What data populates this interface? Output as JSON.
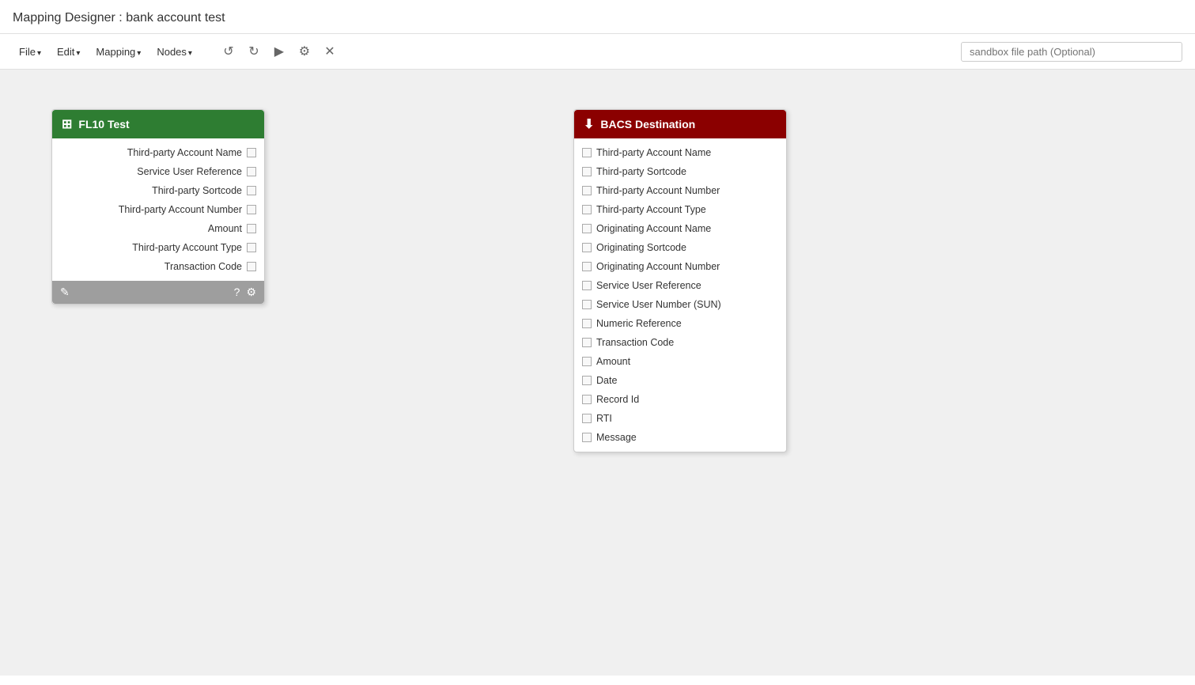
{
  "title": "Mapping Designer : bank account test",
  "toolbar": {
    "file_label": "File",
    "edit_label": "Edit",
    "mapping_label": "Mapping",
    "nodes_label": "Nodes",
    "undo_icon": "↺",
    "redo_icon": "↻",
    "run_icon": "▶",
    "settings_icon": "⚙",
    "close_icon": "✕",
    "sandbox_placeholder": "sandbox file path (Optional)"
  },
  "fl10_node": {
    "title": "FL10 Test",
    "header_icon": "⊞",
    "fields": [
      "Third-party Account Name",
      "Service User Reference",
      "Third-party Sortcode",
      "Third-party Account Number",
      "Amount",
      "Third-party Account Type",
      "Transaction Code"
    ],
    "footer_edit_icon": "✎",
    "footer_help_icon": "?",
    "footer_gear_icon": "⚙"
  },
  "bacs_node": {
    "title": "BACS Destination",
    "header_icon": "⬇",
    "fields": [
      "Third-party Account Name",
      "Third-party Sortcode",
      "Third-party Account Number",
      "Third-party Account Type",
      "Originating Account Name",
      "Originating Sortcode",
      "Originating Account Number",
      "Service User Reference",
      "Service User Number (SUN)",
      "Numeric Reference",
      "Transaction Code",
      "Amount",
      "Date",
      "Record Id",
      "RTI",
      "Message"
    ]
  },
  "colors": {
    "fl10_header": "#2e7d32",
    "bacs_header": "#8b0000",
    "canvas_bg": "#f0f0f0"
  }
}
